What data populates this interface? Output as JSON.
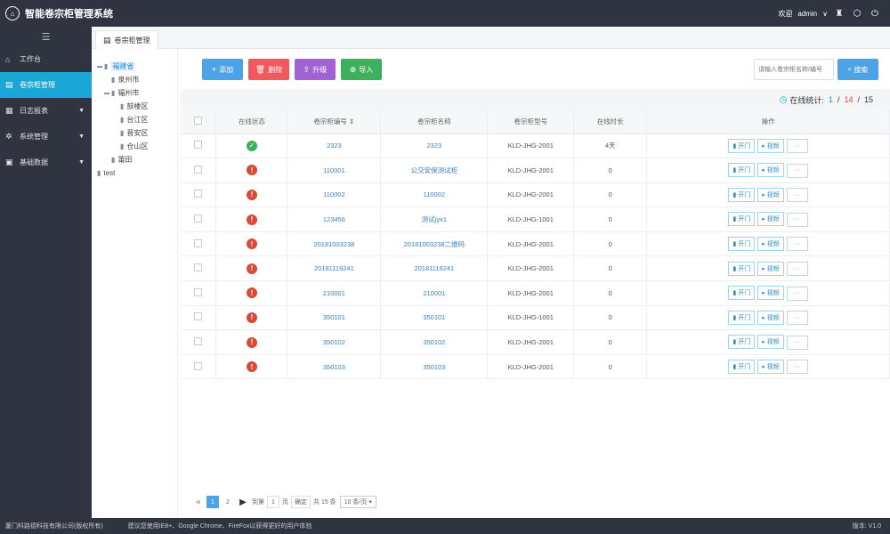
{
  "header": {
    "title": "智能卷宗柜管理系统",
    "welcome": "欢迎",
    "user": "admin"
  },
  "sidebar": {
    "items": [
      {
        "label": "工作台",
        "icon": "home-icon"
      },
      {
        "label": "卷宗柜管理",
        "icon": "cabinet-icon",
        "active": true
      },
      {
        "label": "日志报表",
        "icon": "report-icon"
      },
      {
        "label": "系统管理",
        "icon": "gear-icon"
      },
      {
        "label": "基础数据",
        "icon": "data-icon"
      }
    ]
  },
  "tab": {
    "label": "卷宗柜管理"
  },
  "tree": {
    "nodes": [
      {
        "label": "福建省",
        "level": 0,
        "toggle": "-"
      },
      {
        "label": "泉州市",
        "level": 1
      },
      {
        "label": "福州市",
        "level": 1,
        "toggle": "-"
      },
      {
        "label": "鼓楼区",
        "level": 2
      },
      {
        "label": "台江区",
        "level": 2
      },
      {
        "label": "晋安区",
        "level": 2
      },
      {
        "label": "仓山区",
        "level": 2
      },
      {
        "label": "莆田",
        "level": 1
      },
      {
        "label": "test",
        "level": 0
      }
    ]
  },
  "toolbar": {
    "add": "添加",
    "delete": "删除",
    "upgrade": "升级",
    "import": "导入",
    "search_placeholder": "请输入卷宗柜名称/编号",
    "search": "搜索"
  },
  "stats": {
    "label": "在线统计:",
    "online": "1",
    "offline": "14",
    "total": "15",
    "sep": "/"
  },
  "table": {
    "headers": [
      "在线状态",
      "卷宗柜编号 ⇕",
      "卷宗柜名称",
      "卷宗柜型号",
      "在线时长",
      "操作"
    ],
    "ops": {
      "open": "开门",
      "view": "视频",
      "more": "···"
    },
    "rows": [
      {
        "status": "on",
        "id": "2323",
        "name": "2323",
        "model": "KLD-JHG-2001",
        "time": "4天"
      },
      {
        "status": "off",
        "id": "110001",
        "name": "公交安保测试柜",
        "model": "KLD-JHG-2001",
        "time": "0"
      },
      {
        "status": "off",
        "id": "110002",
        "name": "110002",
        "model": "KLD-JHG-2001",
        "time": "0"
      },
      {
        "status": "off",
        "id": "123456",
        "name": "测试jyx1",
        "model": "KLD-JHG-1001",
        "time": "0"
      },
      {
        "status": "off",
        "id": "20181003238",
        "name": "20181003238二维码",
        "model": "KLD-JHG-2001",
        "time": "0"
      },
      {
        "status": "off",
        "id": "20181119241",
        "name": "20181119241",
        "model": "KLD-JHG-2001",
        "time": "0"
      },
      {
        "status": "off",
        "id": "210001",
        "name": "210001",
        "model": "KLD-JHG-2001",
        "time": "0"
      },
      {
        "status": "off",
        "id": "350101",
        "name": "350101",
        "model": "KLD-JHG-1001",
        "time": "0"
      },
      {
        "status": "off",
        "id": "350102",
        "name": "350102",
        "model": "KLD-JHG-2001",
        "time": "0"
      },
      {
        "status": "off",
        "id": "350103",
        "name": "350103",
        "model": "KLD-JHG-2001",
        "time": "0"
      }
    ]
  },
  "pager": {
    "page1": "1",
    "page2": "2",
    "goto": "到第",
    "goto_value": "1",
    "page_unit": "页",
    "confirm": "确定",
    "total": "共 15 条",
    "per_page": "10 条/页"
  },
  "footer": {
    "company": "厦门科路德科技有限公司(版权所有)",
    "browser_tip": "建议您使用IE8+、Google Chrome、FireFox以获得更好的用户体验",
    "version": "版本: V1.0"
  }
}
